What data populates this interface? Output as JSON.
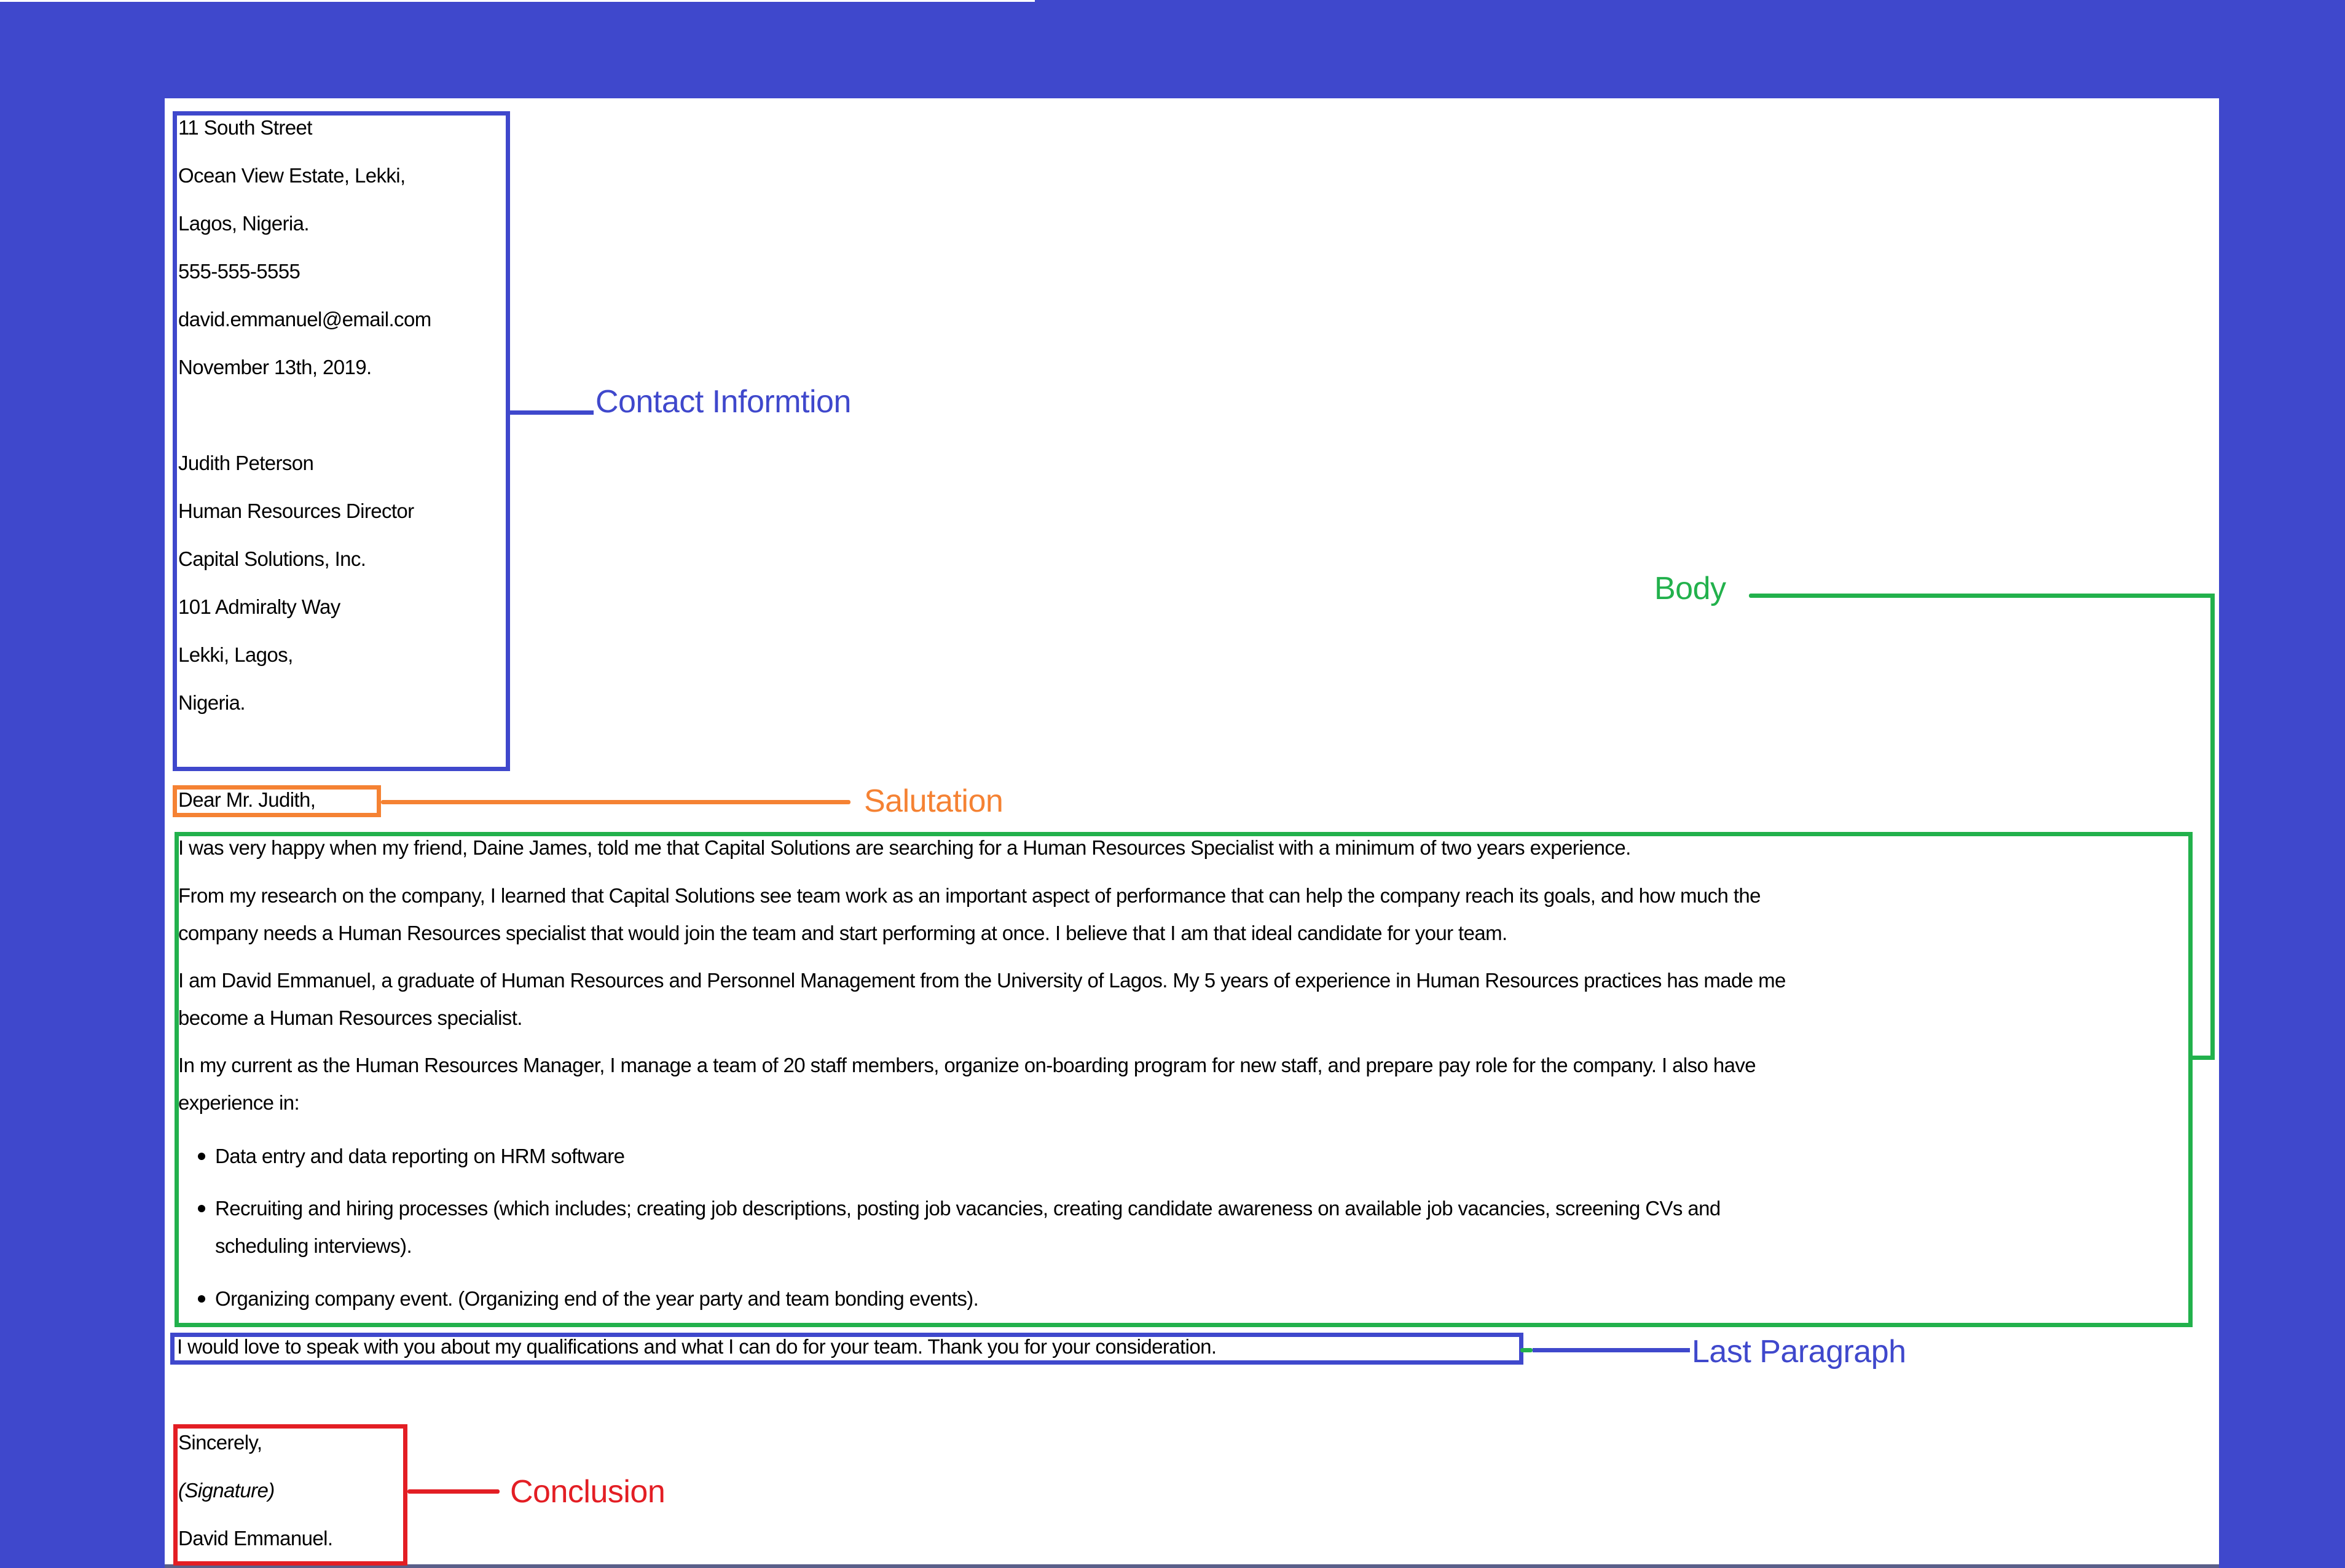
{
  "colors": {
    "background": "#3F48CC",
    "contact": "#3F48CC",
    "salutation": "#F58233",
    "body": "#22B14C",
    "last_paragraph": "#3F48CC",
    "conclusion": "#E31E24"
  },
  "letter": {
    "sender": {
      "street": "11 South Street",
      "estate": "Ocean View Estate, Lekki,",
      "city": "Lagos, Nigeria.",
      "phone": "555-555-5555",
      "email": "david.emmanuel@email.com",
      "date": "November 13th, 2019."
    },
    "recipient": {
      "name": "Judith Peterson",
      "title": "Human Resources Director",
      "company": "Capital Solutions, Inc.",
      "street": "101 Admiralty Way",
      "city": "Lekki, Lagos,",
      "country": "Nigeria."
    },
    "salutation": "Dear Mr. Judith,",
    "body": {
      "paragraphs": [
        [
          "I was very happy when my friend, Daine James, told me that Capital Solutions are searching for a Human Resources Specialist with a minimum of two years experience."
        ],
        [
          "From my research on the company, I learned that Capital Solutions see team work as an important aspect of performance that can help the company reach its goals, and how much the",
          "company needs a Human Resources specialist that would join the team and start performing at once. I believe that I am that ideal candidate for your team."
        ],
        [
          "I am David Emmanuel, a graduate of Human Resources and Personnel Management from the University of Lagos. My 5 years of experience in Human Resources practices has made me",
          "become a Human Resources specialist."
        ],
        [
          "In my current as the Human Resources Manager, I manage a team of 20 staff members, organize on-boarding program for new staff, and prepare pay role for the company. I also have",
          "experience in:"
        ]
      ],
      "bullets": [
        [
          "Data entry and data reporting on HRM software"
        ],
        [
          "Recruiting and hiring processes (which includes; creating job descriptions, posting job vacancies, creating candidate awareness on available job vacancies, screening CVs and",
          "scheduling interviews)."
        ],
        [
          "Organizing company event. (Organizing end of the year party and team bonding events)."
        ]
      ]
    },
    "last_paragraph": "I would love to speak with you about my qualifications and what I can do for your team. Thank you for your consideration.",
    "closing": {
      "sign_off": "Sincerely,",
      "signature": "(Signature)",
      "name": "David Emmanuel."
    }
  },
  "annotations": {
    "contact": "Contact Informtion",
    "salutation": "Salutation",
    "body": "Body",
    "last_paragraph": "Last Paragraph",
    "conclusion": "Conclusion"
  }
}
